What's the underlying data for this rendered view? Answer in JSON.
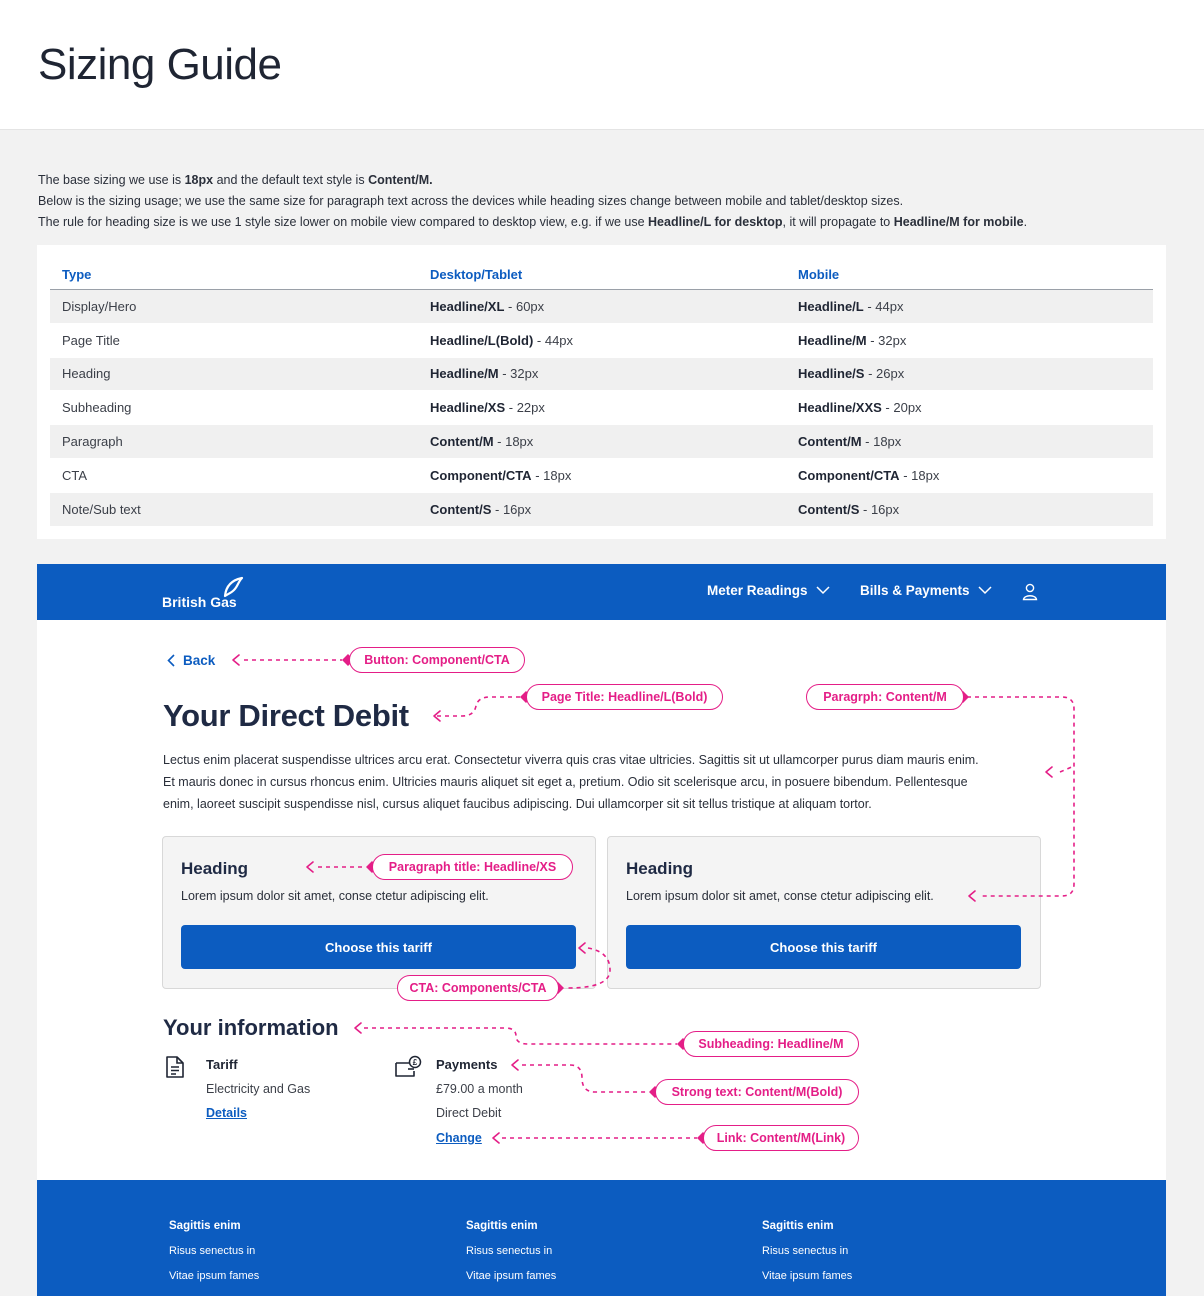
{
  "guide": {
    "title": "Sizing Guide",
    "intro": {
      "l1_a": "The base sizing we use is ",
      "l1_b": "18px",
      "l1_c": " and the default text style is ",
      "l1_d": "Content/M.",
      "l2": "Below is the sizing usage; we use the same size for paragraph text across the devices while heading sizes change between mobile and tablet/desktop sizes.",
      "l3_a": "The rule for heading size is we use 1 style size lower on mobile view compared to desktop view, e.g. if we use ",
      "l3_b": "Headline/L for desktop",
      "l3_c": ", it will propagate to ",
      "l3_d": "Headline/M for mobile",
      "l3_e": "."
    }
  },
  "table": {
    "headers": [
      "Type",
      "Desktop/Tablet",
      "Mobile"
    ],
    "rows": [
      {
        "type": "Display/Hero",
        "d_style": "Headline/XL",
        "d_size": " - 60px",
        "m_style": "Headline/L",
        "m_size": " - 44px"
      },
      {
        "type": "Page Title",
        "d_style": "Headline/L(Bold)",
        "d_size": " - 44px",
        "m_style": "Headline/M",
        "m_size": " - 32px"
      },
      {
        "type": "Heading",
        "d_style": "Headline/M",
        "d_size": " - 32px",
        "m_style": "Headline/S",
        "m_size": " - 26px"
      },
      {
        "type": "Subheading",
        "d_style": "Headline/XS",
        "d_size": " - 22px",
        "m_style": "Headline/XXS",
        "m_size": " - 20px"
      },
      {
        "type": "Paragraph",
        "d_style": "Content/M",
        "d_size": " - 18px",
        "m_style": "Content/M",
        "m_size": " - 18px"
      },
      {
        "type": "CTA",
        "d_style": "Component/CTA",
        "d_size": " - 18px",
        "m_style": "Component/CTA",
        "m_size": " - 18px"
      },
      {
        "type": "Note/Sub text",
        "d_style": "Content/S",
        "d_size": " - 16px",
        "m_style": "Content/S",
        "m_size": " - 16px"
      }
    ]
  },
  "site": {
    "logo": "British Gas",
    "nav": {
      "meter": "Meter Readings",
      "bills": "Bills & Payments"
    },
    "back": "Back",
    "page_title": "Your Direct Debit",
    "lead": [
      "Lectus enim placerat suspendisse ultrices arcu erat. Consectetur viverra quis cras vitae ultricies. Sagittis sit ut ullamcorper purus diam mauris enim.",
      "Et mauris donec in cursus rhoncus enim. Ultricies mauris aliquet sit eget a, pretium. Odio sit scelerisque arcu, in posuere bibendum. Pellentesque",
      "enim, laoreet suscipit suspendisse nisl, cursus aliquet faucibus adipiscing. Dui ullamcorper sit sit tellus tristique at aliquam tortor."
    ],
    "cards": [
      {
        "heading": "Heading",
        "text": "Lorem ipsum dolor sit amet, conse ctetur adipiscing elit.",
        "cta": "Choose this tariff"
      },
      {
        "heading": "Heading",
        "text": "Lorem ipsum dolor sit amet, conse ctetur adipiscing elit.",
        "cta": "Choose this tariff"
      }
    ],
    "info_title": "Your information",
    "tariff": {
      "title": "Tariff",
      "line1": "Electricity and Gas",
      "link": "Details"
    },
    "payments": {
      "title": "Payments",
      "line1": "£79.00 a month",
      "line2": "Direct Debit",
      "link": "Change"
    },
    "footer": [
      {
        "heading": "Sagittis enim",
        "l1": "Risus senectus in",
        "l2": "Vitae ipsum fames"
      },
      {
        "heading": "Sagittis enim",
        "l1": "Risus senectus in",
        "l2": "Vitae ipsum fames"
      },
      {
        "heading": "Sagittis enim",
        "l1": "Risus senectus in",
        "l2": "Vitae ipsum fames"
      }
    ]
  },
  "annotations": {
    "button": "Button: Component/CTA",
    "page_title": "Page Title: Headline/L(Bold)",
    "paragraph": "Paragrph: Content/M",
    "paragraph_title": "Paragraph title: Headline/XS",
    "cta": "CTA: Components/CTA",
    "subheading": "Subheading: Headline/M",
    "strong": "Strong text: Content/M(Bold)",
    "link": "Link: Content/M(Link)"
  },
  "colors": {
    "brand_blue": "#0c5cc0",
    "annotation_pink": "#e41e87",
    "page_bg": "#f2f2f2"
  }
}
